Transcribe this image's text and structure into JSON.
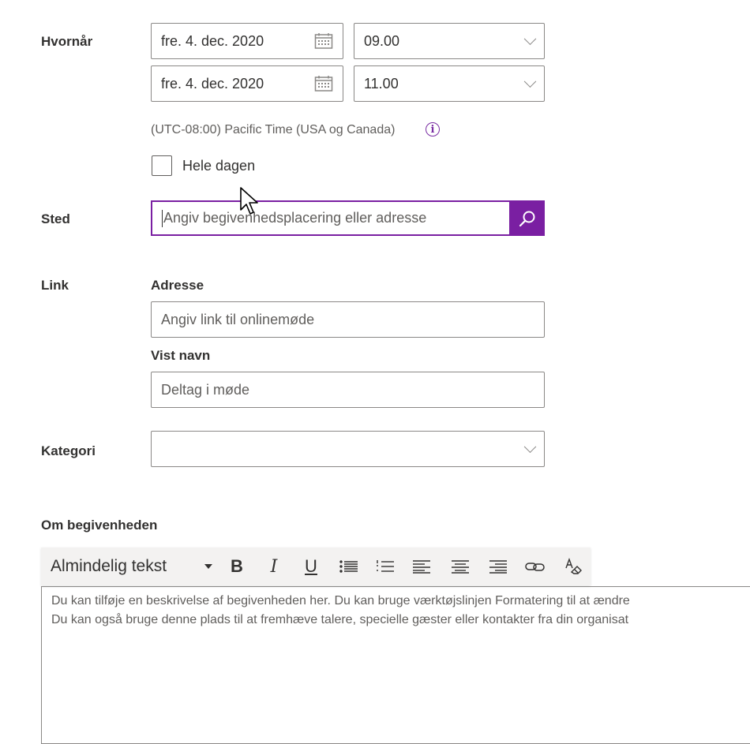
{
  "when": {
    "label": "Hvornår",
    "start_date": "fre. 4. dec. 2020",
    "start_time": "09.00",
    "end_date": "fre. 4. dec. 2020",
    "end_time": "11.00",
    "timezone": "(UTC-08:00) Pacific Time (USA og Canada)",
    "all_day_label": "Hele dagen",
    "all_day_checked": false
  },
  "location": {
    "label": "Sted",
    "placeholder": "Angiv begivenhedsplacering eller adresse"
  },
  "link": {
    "label": "Link",
    "address_label": "Adresse",
    "address_placeholder": "Angiv link til onlinemøde",
    "display_name_label": "Vist navn",
    "display_name_placeholder": "Deltag i møde"
  },
  "category": {
    "label": "Kategori",
    "value": ""
  },
  "about": {
    "label": "Om begivenheden",
    "toolbar": {
      "style_select": "Almindelig tekst",
      "bold": "B",
      "italic": "I",
      "underline": "U"
    },
    "editor_lines": [
      "Du kan tilføje en beskrivelse af begivenheden her. Du kan bruge værktøjslinjen Formatering til at ændre",
      "Du kan også bruge denne plads til at fremhæve talere, specielle gæster eller kontakter fra din organisat"
    ]
  },
  "colors": {
    "accent": "#7a1fa2",
    "border": "#8a8886",
    "text": "#323130"
  }
}
